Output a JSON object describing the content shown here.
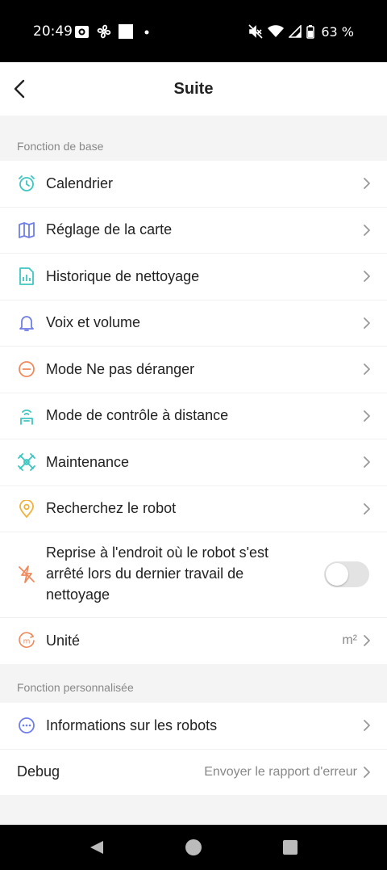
{
  "status_bar": {
    "time": "20:49",
    "battery_text": "63 %",
    "left_icons": [
      "screen-record-icon",
      "fan-icon",
      "square-notification-icon",
      "dot-icon"
    ],
    "right_icons": [
      "mute-icon",
      "wifi-icon",
      "signal-icon",
      "battery-icon"
    ]
  },
  "header": {
    "title": "Suite"
  },
  "sections": {
    "basic": {
      "title": "Fonction de base",
      "items": [
        {
          "label": "Calendrier",
          "icon": "alarm-clock-icon",
          "icon_color": "#3ec6c0"
        },
        {
          "label": "Réglage de la carte",
          "icon": "map-icon",
          "icon_color": "#6f7fe6"
        },
        {
          "label": "Historique de nettoyage",
          "icon": "report-chart-icon",
          "icon_color": "#3ec6c0"
        },
        {
          "label": "Voix et volume",
          "icon": "bell-icon",
          "icon_color": "#6f7fe6"
        },
        {
          "label": "Mode Ne pas déranger",
          "icon": "minus-circle-icon",
          "icon_color": "#f08a5d"
        },
        {
          "label": "Mode de contrôle à distance",
          "icon": "remote-control-icon",
          "icon_color": "#3ec6c0"
        },
        {
          "label": "Maintenance",
          "icon": "maintenance-icon",
          "icon_color": "#3ec6c0"
        },
        {
          "label": "Recherchez le robot",
          "icon": "location-pin-icon",
          "icon_color": "#f0b23c"
        }
      ],
      "resume": {
        "label": "Reprise à l'endroit où le robot s'est arrêté lors du dernier travail de nettoyage",
        "icon": "flash-off-icon",
        "icon_color": "#f08a5d",
        "enabled": false
      },
      "unit": {
        "label": "Unité",
        "value": "m²",
        "icon": "unit-m-icon",
        "icon_color": "#f08a5d"
      }
    },
    "custom": {
      "title": "Fonction personnalisée",
      "info": {
        "label": "Informations sur les robots",
        "icon": "more-circle-icon",
        "icon_color": "#6f7fe6"
      },
      "debug": {
        "label": "Debug",
        "value": "Envoyer le rapport d'erreur"
      }
    }
  },
  "nav_bar": {
    "icons": [
      "back-triangle-icon",
      "home-circle-icon",
      "recents-square-icon"
    ]
  }
}
